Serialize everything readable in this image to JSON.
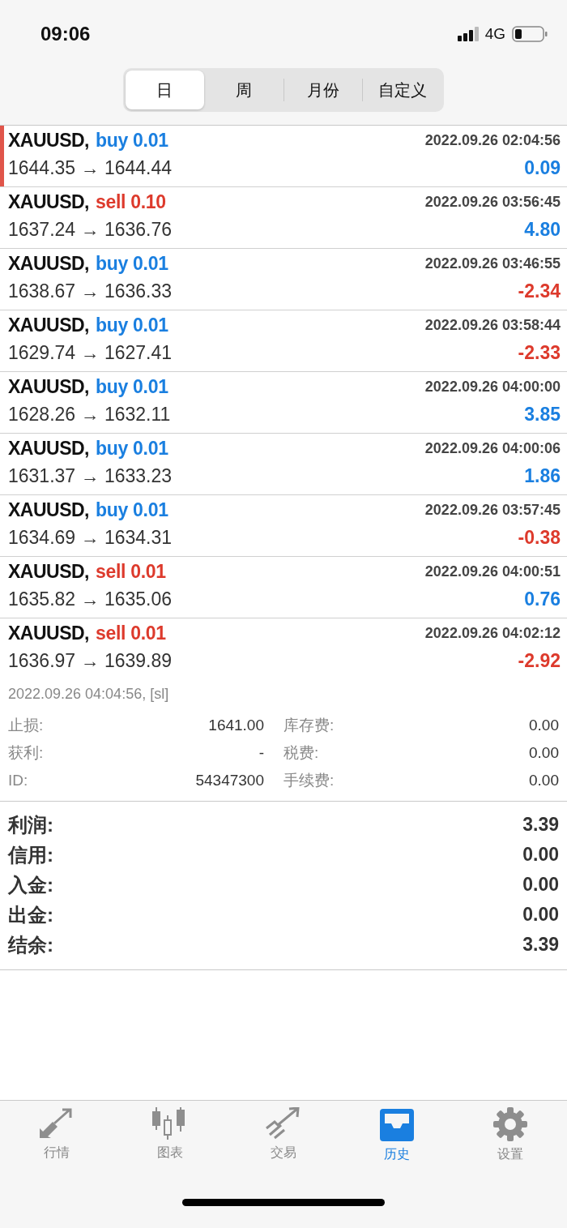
{
  "status_bar": {
    "time": "09:06",
    "network": "4G"
  },
  "period_tabs": [
    {
      "label": "日",
      "selected": true
    },
    {
      "label": "周",
      "selected": false
    },
    {
      "label": "月份",
      "selected": false
    },
    {
      "label": "自定义",
      "selected": false
    }
  ],
  "trades": [
    {
      "symbol": "XAUUSD,",
      "kind": "buy",
      "volume": "buy 0.01",
      "time": "2022.09.26 02:04:56",
      "prices": "1644.35 → 1644.44",
      "profit": "0.09",
      "negative": false,
      "selected": true,
      "expanded": false
    },
    {
      "symbol": "XAUUSD,",
      "kind": "sell",
      "volume": "sell 0.10",
      "time": "2022.09.26 03:56:45",
      "prices": "1637.24 → 1636.76",
      "profit": "4.80",
      "negative": false,
      "selected": false,
      "expanded": false
    },
    {
      "symbol": "XAUUSD,",
      "kind": "buy",
      "volume": "buy 0.01",
      "time": "2022.09.26 03:46:55",
      "prices": "1638.67 → 1636.33",
      "profit": "-2.34",
      "negative": true,
      "selected": false,
      "expanded": false
    },
    {
      "symbol": "XAUUSD,",
      "kind": "buy",
      "volume": "buy 0.01",
      "time": "2022.09.26 03:58:44",
      "prices": "1629.74 → 1627.41",
      "profit": "-2.33",
      "negative": true,
      "selected": false,
      "expanded": false
    },
    {
      "symbol": "XAUUSD,",
      "kind": "buy",
      "volume": "buy 0.01",
      "time": "2022.09.26 04:00:00",
      "prices": "1628.26 → 1632.11",
      "profit": "3.85",
      "negative": false,
      "selected": false,
      "expanded": false
    },
    {
      "symbol": "XAUUSD,",
      "kind": "buy",
      "volume": "buy 0.01",
      "time": "2022.09.26 04:00:06",
      "prices": "1631.37 → 1633.23",
      "profit": "1.86",
      "negative": false,
      "selected": false,
      "expanded": false
    },
    {
      "symbol": "XAUUSD,",
      "kind": "buy",
      "volume": "buy 0.01",
      "time": "2022.09.26 03:57:45",
      "prices": "1634.69 → 1634.31",
      "profit": "-0.38",
      "negative": true,
      "selected": false,
      "expanded": false
    },
    {
      "symbol": "XAUUSD,",
      "kind": "sell",
      "volume": "sell 0.01",
      "time": "2022.09.26 04:00:51",
      "prices": "1635.82 → 1635.06",
      "profit": "0.76",
      "negative": false,
      "selected": false,
      "expanded": false
    },
    {
      "symbol": "XAUUSD,",
      "kind": "sell",
      "volume": "sell 0.01",
      "time": "2022.09.26 04:02:12",
      "prices": "1636.97 → 1639.89",
      "profit": "-2.92",
      "negative": true,
      "selected": false,
      "expanded": true,
      "details": {
        "close_info": "2022.09.26 04:04:56, [sl]",
        "fields": [
          {
            "label": "止损:",
            "value": "1641.00"
          },
          {
            "label": "库存费:",
            "value": "0.00"
          },
          {
            "label": "获利:",
            "value": "-"
          },
          {
            "label": "税费:",
            "value": "0.00"
          },
          {
            "label": "ID:",
            "value": "54347300"
          },
          {
            "label": "手续费:",
            "value": "0.00"
          }
        ]
      }
    }
  ],
  "summary": [
    {
      "label": "利润:",
      "value": "3.39"
    },
    {
      "label": "信用:",
      "value": "0.00"
    },
    {
      "label": "入金:",
      "value": "0.00"
    },
    {
      "label": "出金:",
      "value": "0.00"
    },
    {
      "label": "结余:",
      "value": "3.39"
    }
  ],
  "bottom_tabs": [
    {
      "label": "行情",
      "kind": "quotes",
      "selected": false
    },
    {
      "label": "图表",
      "kind": "chart",
      "selected": false
    },
    {
      "label": "交易",
      "kind": "trade",
      "selected": false
    },
    {
      "label": "历史",
      "kind": "history",
      "selected": true
    },
    {
      "label": "设置",
      "kind": "settings",
      "selected": false
    }
  ]
}
